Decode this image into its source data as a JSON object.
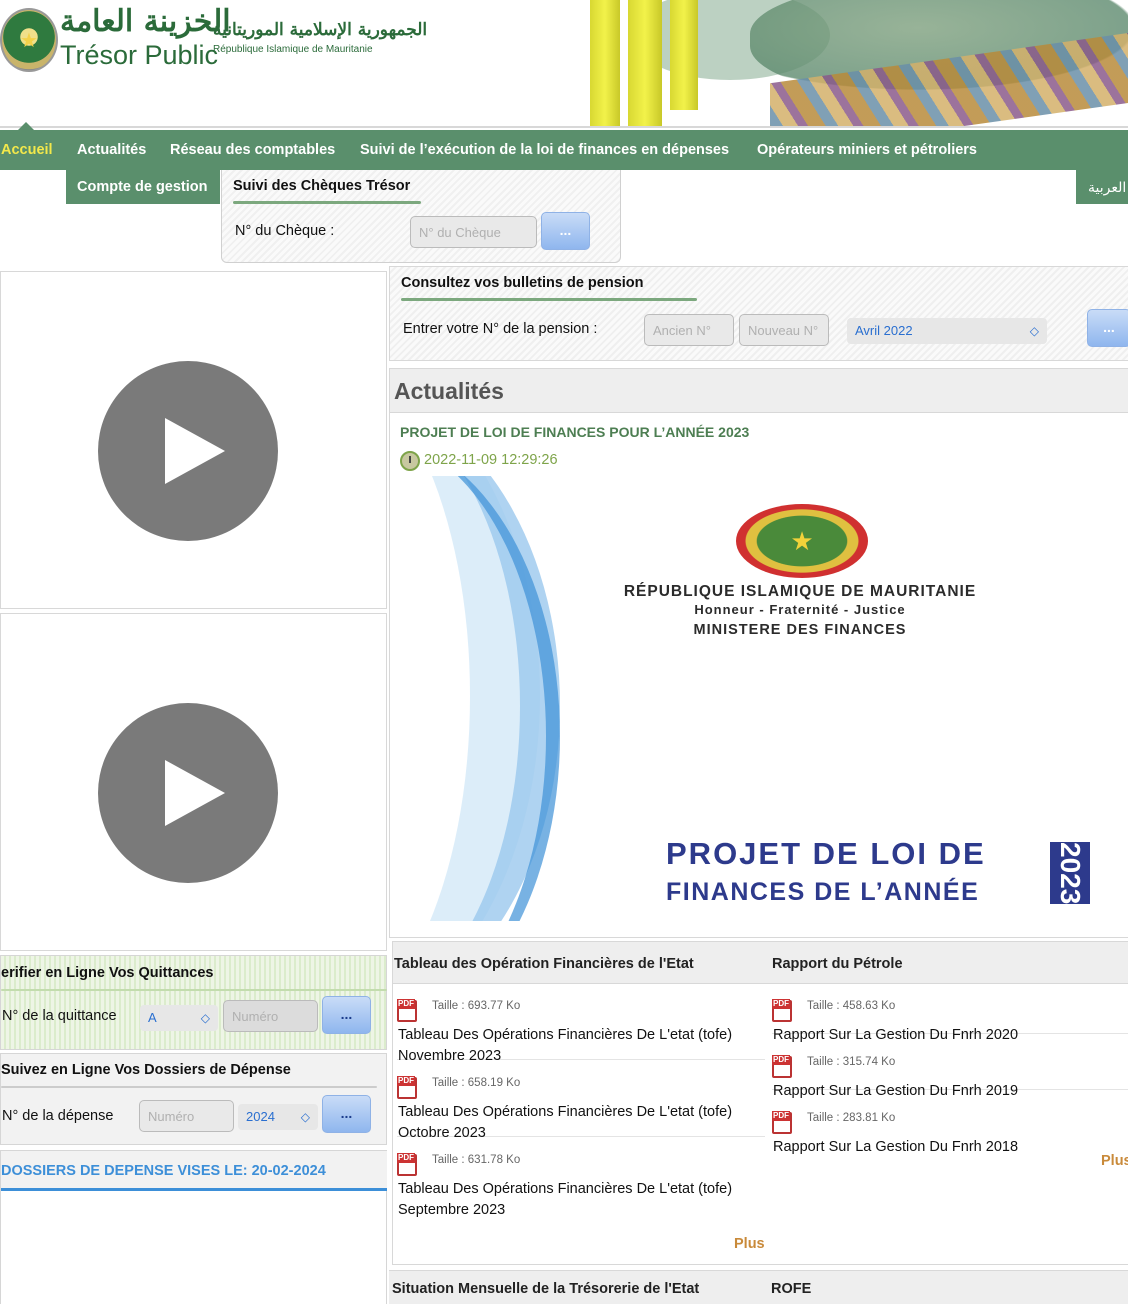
{
  "header": {
    "brand_ar": "الخزينة العامة",
    "brand_fr": "Trésor Public",
    "republic_ar": "الجمهورية الإسلامية الموريتانية",
    "republic_fr": "République Islamique de Mauritanie"
  },
  "nav": {
    "items": [
      "Accueil",
      "Actualités",
      "Réseau des comptables",
      "Suivi de l’exécution de la loi de finances en dépenses",
      "Opérateurs miniers et pétroliers"
    ],
    "sub_item": "Compte de gestion",
    "lang": "العربية"
  },
  "cheque": {
    "title": "Suivi des Chèques Trésor",
    "label": "N° du Chèque :",
    "placeholder": "N° du Chèque",
    "button": "..."
  },
  "pension": {
    "title": "Consultez vos bulletins de pension",
    "label": "Entrer votre N° de la pension :",
    "old_placeholder": "Ancien N°",
    "new_placeholder": "Nouveau N°",
    "month_selected": "Avril 2022",
    "button": "..."
  },
  "quittance": {
    "title": "erifier en Ligne Vos Quittances",
    "label": "N° de la quittance",
    "select_value": "A",
    "placeholder": "Numéro",
    "button": "..."
  },
  "depense": {
    "title": "Suivez en Ligne Vos Dossiers de Dépense",
    "label": "N° de la dépense",
    "placeholder": "Numéro",
    "year_selected": "2024",
    "button": "..."
  },
  "vises": {
    "text": "DOSSIERS DE DEPENSE VISES LE: 20-02-2024"
  },
  "news": {
    "heading": "Actualités",
    "title": "PROJET DE LOI DE FINANCES POUR L’ANNÉE 2023",
    "date": "2022-11-09 12:29:26",
    "cover": {
      "line1": "RÉPUBLIQUE ISLAMIQUE DE MAURITANIE",
      "line2": "Honneur - Fraternité - Justice",
      "line3": "MINISTERE DES FINANCES",
      "big1": "PROJET DE LOI DE",
      "big2": "FINANCES DE L’ANNÉE",
      "year": "2023"
    }
  },
  "tofe": {
    "heading": "Tableau des Opération Financières de l'Etat",
    "docs": [
      {
        "size": "Taille : 693.77 Ko",
        "name": "Tableau Des Opérations Financières De L'etat (tofe) Novembre 2023"
      },
      {
        "size": "Taille : 658.19 Ko",
        "name": "Tableau Des Opérations Financières De L'etat (tofe) Octobre 2023"
      },
      {
        "size": "Taille : 631.78 Ko",
        "name": "Tableau Des Opérations Financières De L'etat (tofe) Septembre 2023"
      }
    ],
    "more": "Plus"
  },
  "petrole": {
    "heading": "Rapport du Pétrole",
    "docs": [
      {
        "size": "Taille : 458.63 Ko",
        "name": "Rapport Sur La Gestion Du Fnrh 2020"
      },
      {
        "size": "Taille : 315.74 Ko",
        "name": "Rapport Sur La Gestion Du Fnrh 2019"
      },
      {
        "size": "Taille : 283.81 Ko",
        "name": "Rapport Sur La Gestion Du Fnrh 2018"
      }
    ],
    "more": "Plus"
  },
  "bottom": {
    "left": "Situation Mensuelle de la Trésorerie de l'Etat",
    "right": "ROFE"
  }
}
